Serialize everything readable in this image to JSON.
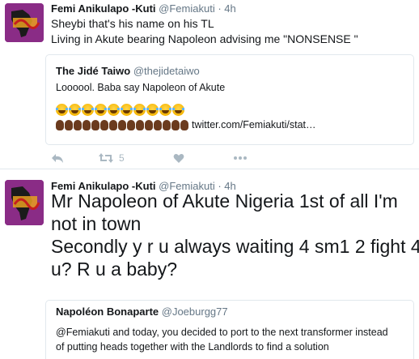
{
  "tweets": [
    {
      "name": "Femi Anikulapo -Kuti",
      "handle": "@Femiakuti",
      "separator": "·",
      "time": "4h",
      "text_lines": [
        "Sheybi that's his name on his TL",
        "Living in Akute bearing Napoleon advising me \"NONSENSE \""
      ],
      "quote": {
        "name": "The Jidé Taiwo",
        "handle": "@thejidetaiwo",
        "text": "Loooool. Baba say Napoleon of Akute",
        "laugh_emoji_count": 10,
        "clap_emoji_count": 15,
        "link": "twitter.com/Femiakuti/stat…"
      },
      "actions": {
        "retweet_count": "5"
      }
    },
    {
      "name": "Femi Anikulapo -Kuti",
      "handle": "@Femiakuti",
      "separator": "·",
      "time": "4h",
      "text_lines": [
        "Mr Napoleon of Akute Nigeria 1st of all I'm",
        "not in town",
        "Secondly y r u always waiting 4 sm1 2 fight 4",
        "u? R u a baby?"
      ],
      "quote": {
        "name": "Napoléon Bonaparte",
        "handle": "@Joeburgg77",
        "text_lines": [
          "@Femiakuti and today, you decided to port to the next transformer instead",
          "of putting heads together with the Landlords to find a solution"
        ]
      }
    }
  ],
  "icons": {
    "avatar": "avatar-image",
    "reply": "reply-icon",
    "retweet": "retweet-icon",
    "like": "heart-icon",
    "more": "more-dots-icon"
  },
  "colors": {
    "secondary_text": "#657786",
    "action_icon": "#aab8c2",
    "border": "#e1e8ed"
  }
}
